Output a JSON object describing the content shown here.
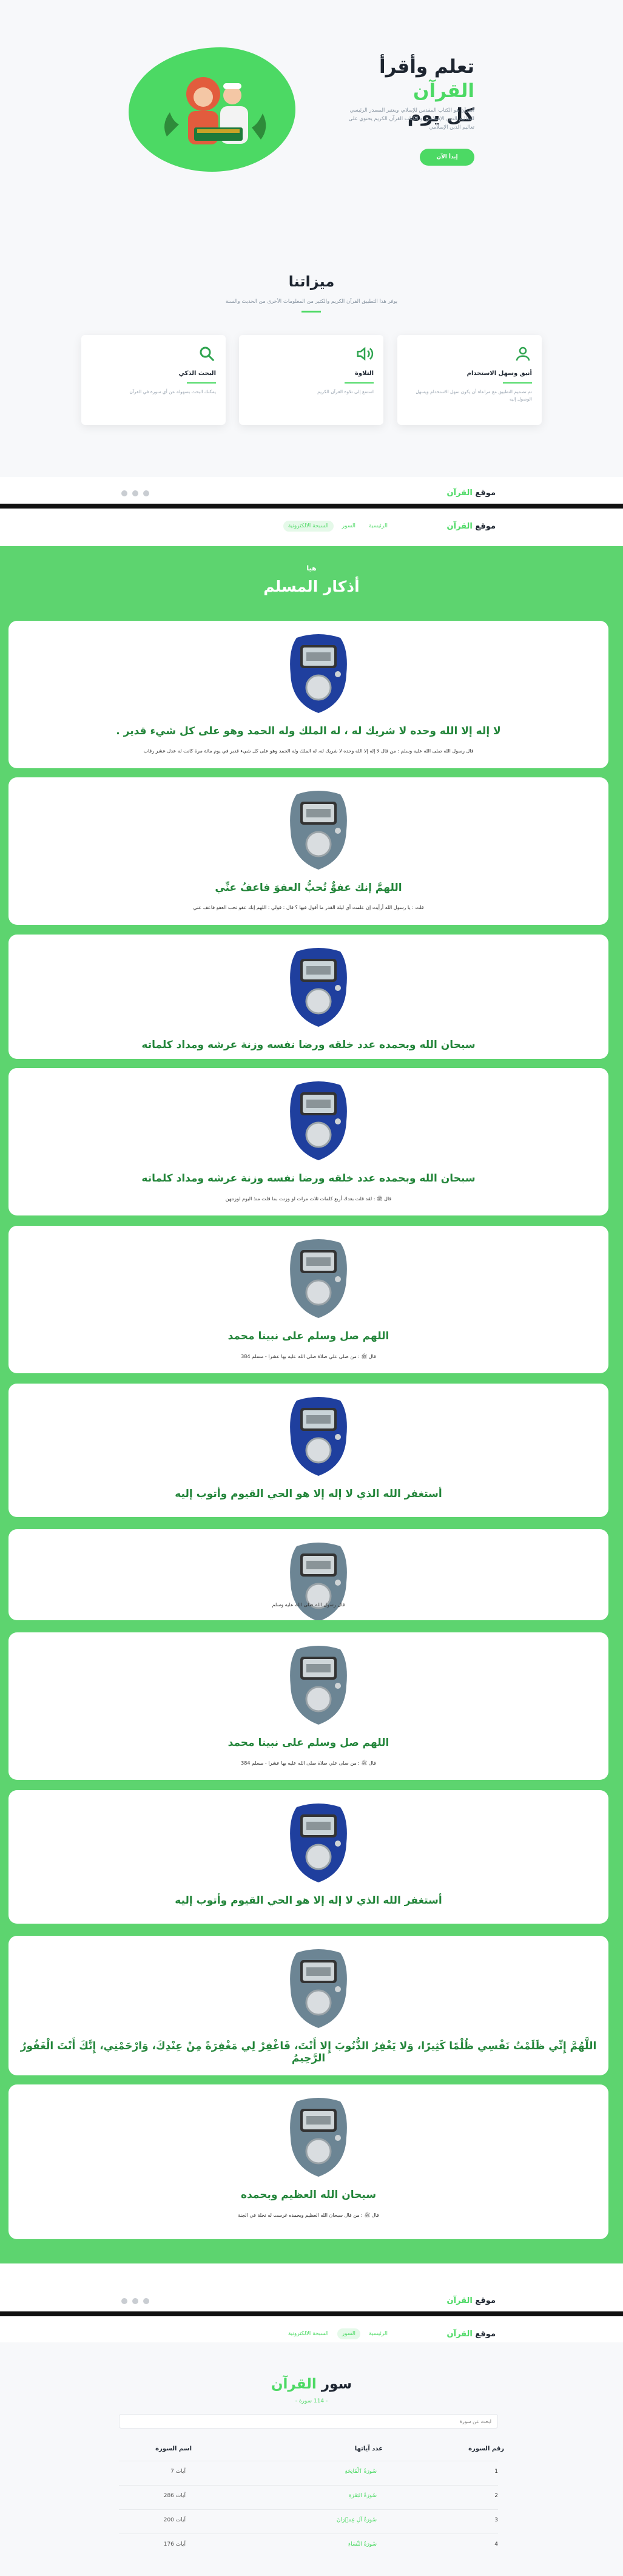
{
  "hero": {
    "title_part1": "تعلم وأقرأ",
    "title_green": "القرآن",
    "title_part2": "كل يوم",
    "description": "القرآن هو الكتاب المقدس للإسلام، ويعتبر المصدر الرئيسي للتعاليم الدين الإسلامي. و الكتاب القرآن الكريم يحتوي على تعاليم الدين الإسلامي",
    "cta_label": "إبدأ الآن"
  },
  "features": {
    "title": "ميزاتنا",
    "subtitle": "يوفر هذا التطبيق القرآن الكريم والكثير من المعلومات الأخرى من الحديث والسنة",
    "cards": [
      {
        "title": "أنيق وسهل الاستخدام",
        "desc": "تم تصميم التطبيق مع مراعاة أن يكون سهل الاستخدام ويسهل الوصول إليه",
        "icon": "user-icon"
      },
      {
        "title": "التلاوة",
        "desc": "استمع إلى تلاوة القرآن الكريم",
        "icon": "speaker-icon"
      },
      {
        "title": "البحث الذكي",
        "desc": "يمكنك البحث بسهولة عن أي سورة في القرآن",
        "icon": "search-icon"
      }
    ]
  },
  "brand": {
    "prefix": "موقع",
    "name": "القرآن"
  },
  "nav": {
    "home": "الرئيسية",
    "surah": "السور",
    "adhkar": "السبحة الالكترونية"
  },
  "adhkar": {
    "pre_title": "هيا",
    "title": "أذكار المسلم",
    "items": [
      {
        "text": "لا إله إلا الله وحده لا شريك له ، له الملك وله الحمد وهو على كل شيء قدير .",
        "note": "قال رسول الله صلى الله عليه وسلم : من قال لا إله إلا الله وحده لا شريك له، له الملك وله الحمد وهو على كل شيء قدير في يوم مائة مرة كانت له عدل عشر رقاب"
      },
      {
        "text": "اللهمَّ إنك عفوٌّ تُحبُّ العفوَ فاعفُ عنِّي",
        "note": "قلت : يا رسول الله أرأيت إن علمت أي ليلة القدر ما أقول فيها ؟ قال : قولي : اللهم إنك عفو تحب العفو فاعف عني"
      },
      {
        "text": "سبحان الله وبحمده عدد خلقه ورضا نفسه وزنة عرشه ومداد كلماته",
        "note": ""
      },
      {
        "text": "سبحان الله وبحمده عدد خلقه ورضا نفسه وزنة عرشه ومداد كلماته",
        "note": "قال ﷺ : لقد قلت بعدك أربع كلمات ثلاث مرات لو وزنت بما قلت منذ اليوم لوزنتهن"
      },
      {
        "text": "اللهم صل وسلم على نبينا محمد",
        "note": "قال ﷺ : من صلى علي صلاة صلى الله عليه بها عشرا - مسلم 384"
      },
      {
        "text": "أستغفر الله الذي لا إله إلا هو الحي القيوم وأتوب إليه",
        "note": ""
      },
      {
        "text": "",
        "note": "قال رسول الله صلى الله عليه وسلم"
      },
      {
        "text": "اللهم صل وسلم على نبينا محمد",
        "note": "قال ﷺ : من صلى علي صلاة صلى الله عليه بها عشرا - مسلم 384"
      },
      {
        "text": "أستغفر الله الذي لا إله إلا هو الحي القيوم وأتوب إليه",
        "note": ""
      },
      {
        "text": "اللَّهُمَّ إِنِّي ظَلَمْتُ نَفْسِي ظُلْمًا كَثِيرًا، وَلا يَغْفِرُ الذُّنُوبَ إِلا أَنْتَ، فَاغْفِرْ لِي مَغْفِرَةً مِنْ عِنْدِكَ، وَارْحَمْنِي، إِنَّكَ أَنْتَ الْغَفُورُ الرَّحِيمُ",
        "note": ""
      },
      {
        "text": "سبحان الله العظيم وبحمده",
        "note": "قال ﷺ : من قال سبحان الله العظيم وبحمده غرست له نخلة في الجنة"
      }
    ]
  },
  "surah": {
    "title_part1": "سور",
    "title_green": "القرآن",
    "count": "- 114 سورة -",
    "search_placeholder": "ابحث عن سورة",
    "headers": {
      "number": "رقم السورة",
      "name": "اسم السورة",
      "ayat": "عدد آياتها"
    },
    "rows": [
      {
        "number": "1",
        "name": "سُورَةُ ٱلْفَاتِحَةِ",
        "ayat": "آيات 7"
      },
      {
        "number": "2",
        "name": "سُورَةُ البَقَرَةِ",
        "ayat": "آيات 286"
      },
      {
        "number": "3",
        "name": "سُورَةُ آلِ عِمۡرَانَ",
        "ayat": "آيات 200"
      },
      {
        "number": "4",
        "name": "سُورَةُ النِّسَاءِ",
        "ayat": "آيات 176"
      }
    ]
  },
  "colors": {
    "accent": "#4cd964",
    "dark_green": "#23853a",
    "text_dark": "#1d2530"
  }
}
